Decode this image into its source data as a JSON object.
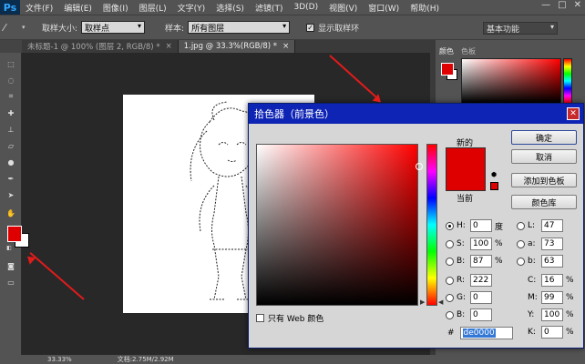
{
  "menubar": {
    "logo": "Ps",
    "items": [
      "文件(F)",
      "编辑(E)",
      "图像(I)",
      "图层(L)",
      "文字(Y)",
      "选择(S)",
      "滤镜(T)",
      "3D(D)",
      "视图(V)",
      "窗口(W)",
      "帮助(H)"
    ],
    "min": "—",
    "max": "□",
    "close": "✕"
  },
  "options": {
    "sample_size_label": "取样大小:",
    "sample_size_value": "取样点",
    "sample_label": "样本:",
    "sample_value": "所有图层",
    "ring_label": "显示取样环",
    "workspace": "基本功能"
  },
  "tabs": [
    {
      "label": "未标题-1 @ 100% (图层 2, RGB/8) *",
      "close": "×"
    },
    {
      "label": "1.jpg @ 33.3%(RGB/8) *",
      "close": "×"
    }
  ],
  "status": {
    "zoom": "33.33%",
    "doc": "文档:2.75M/2.92M"
  },
  "panel": {
    "tabs": [
      "颜色",
      "色板"
    ]
  },
  "picker": {
    "title": "拾色器（前景色）",
    "close": "✕",
    "new_label": "新的",
    "current_label": "当前",
    "buttons": {
      "ok": "确定",
      "cancel": "取消",
      "add_swatch": "添加到色板",
      "libraries": "颜色库"
    },
    "web_only": "只有 Web 颜色",
    "fields": {
      "H": {
        "label": "H:",
        "value": "0",
        "unit": "度"
      },
      "S": {
        "label": "S:",
        "value": "100",
        "unit": "%"
      },
      "B": {
        "label": "B:",
        "value": "87",
        "unit": "%"
      },
      "R": {
        "label": "R:",
        "value": "222",
        "unit": ""
      },
      "G": {
        "label": "G:",
        "value": "0",
        "unit": ""
      },
      "Bb": {
        "label": "B:",
        "value": "0",
        "unit": ""
      },
      "L": {
        "label": "L:",
        "value": "47",
        "unit": ""
      },
      "a": {
        "label": "a:",
        "value": "73",
        "unit": ""
      },
      "b": {
        "label": "b:",
        "value": "63",
        "unit": ""
      },
      "C": {
        "label": "C:",
        "value": "16",
        "unit": "%"
      },
      "M": {
        "label": "M:",
        "value": "99",
        "unit": "%"
      },
      "Y": {
        "label": "Y:",
        "value": "100",
        "unit": "%"
      },
      "K": {
        "label": "K:",
        "value": "0",
        "unit": "%"
      }
    },
    "hex_label": "#",
    "hex_value": "de0000"
  },
  "colors": {
    "foreground": "#de0000",
    "background": "#ffffff",
    "title_bar": "#0e24b4",
    "arrow": "#e21b1b"
  }
}
